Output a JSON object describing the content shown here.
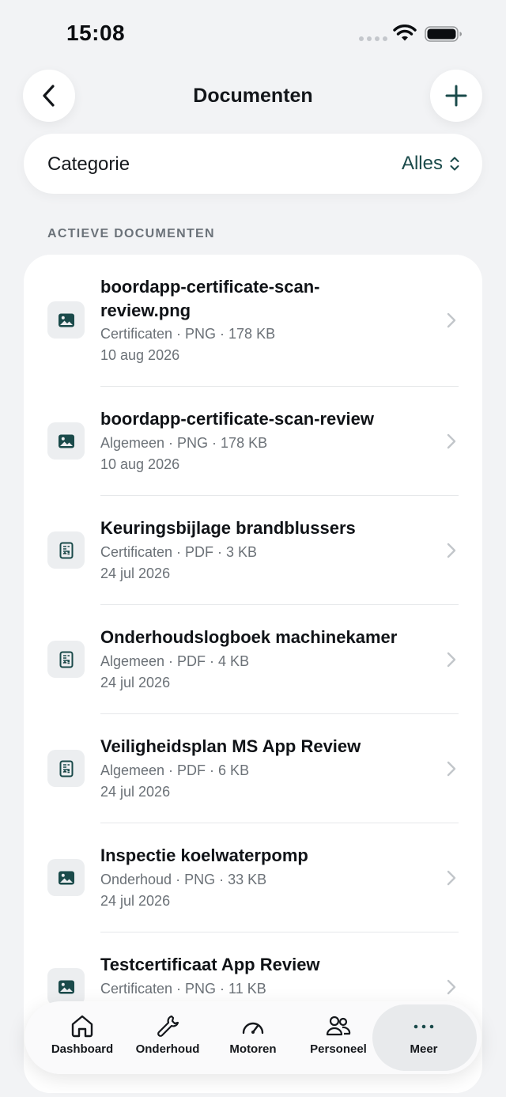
{
  "status_bar": {
    "time": "15:08"
  },
  "header": {
    "title": "Documenten"
  },
  "filter": {
    "label": "Categorie",
    "value": "Alles"
  },
  "section": {
    "heading": "ACTIEVE DOCUMENTEN"
  },
  "documents": [
    {
      "title": "boordapp-certificate-scan-review.png",
      "meta": "Certificaten · PNG · 178 KB",
      "date": "10 aug 2026",
      "icon": "image-icon"
    },
    {
      "title": "boordapp-certificate-scan-review",
      "meta": "Algemeen · PNG · 178 KB",
      "date": "10 aug 2026",
      "icon": "image-icon"
    },
    {
      "title": "Keuringsbijlage brandblussers",
      "meta": "Certificaten · PDF · 3 KB",
      "date": "24 jul 2026",
      "icon": "pdf-icon"
    },
    {
      "title": "Onderhoudslogboek machinekamer",
      "meta": "Algemeen · PDF · 4 KB",
      "date": "24 jul 2026",
      "icon": "pdf-icon"
    },
    {
      "title": "Veiligheidsplan MS App Review",
      "meta": "Algemeen · PDF · 6 KB",
      "date": "24 jul 2026",
      "icon": "pdf-icon"
    },
    {
      "title": "Inspectie koelwaterpomp",
      "meta": "Onderhoud · PNG · 33 KB",
      "date": "24 jul 2026",
      "icon": "image-icon"
    },
    {
      "title": "Testcertificaat App Review",
      "meta": "Certificaten · PNG · 11 KB",
      "date": "",
      "icon": "image-icon"
    }
  ],
  "tab_bar": {
    "items": [
      {
        "label": "Dashboard",
        "icon": "home-icon"
      },
      {
        "label": "Onderhoud",
        "icon": "wrench-icon"
      },
      {
        "label": "Motoren",
        "icon": "gauge-icon"
      },
      {
        "label": "Personeel",
        "icon": "people-icon"
      },
      {
        "label": "Meer",
        "icon": "more-icon",
        "active": true
      }
    ]
  },
  "colors": {
    "accent": "#1a4a4a",
    "background": "#f2f3f5"
  }
}
